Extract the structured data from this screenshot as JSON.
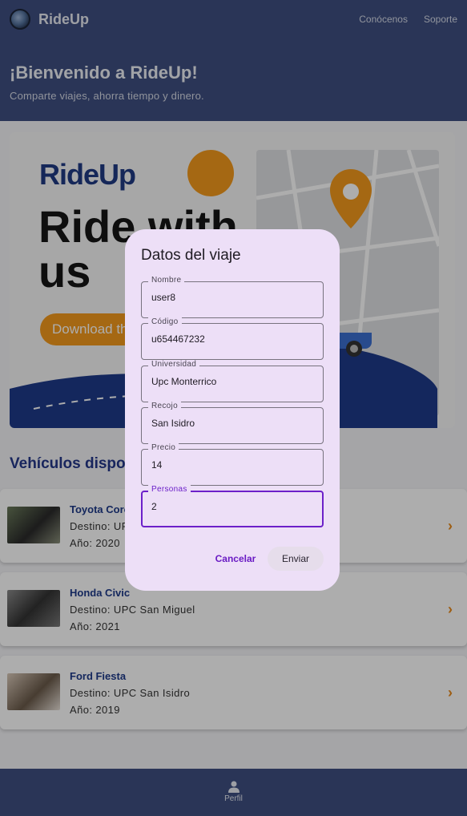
{
  "app": {
    "brand": "RideUp",
    "nav": [
      "Conócenos",
      "Soporte"
    ]
  },
  "hero": {
    "title": "¡Bienvenido a RideUp!",
    "subtitle": "Comparte viajes, ahorra tiempo y dinero."
  },
  "banner": {
    "logo": "RideUp",
    "headline_line1": "Ride with",
    "headline_line2": "us",
    "download": "Download the app"
  },
  "vehicles": {
    "title": "Vehículos disponibles",
    "items": [
      {
        "name": "Toyota Corolla",
        "destino": "Destino: UPC Monterrico",
        "anio": "Año: 2020"
      },
      {
        "name": "Honda Civic",
        "destino": "Destino: UPC San Miguel",
        "anio": "Año: 2021"
      },
      {
        "name": "Ford Fiesta",
        "destino": "Destino: UPC San Isidro",
        "anio": "Año: 2019"
      }
    ]
  },
  "bottom_nav": {
    "label": "Perfil"
  },
  "dialog": {
    "title": "Datos del viaje",
    "fields": [
      {
        "label": "Nombre",
        "value": "user8"
      },
      {
        "label": "Código",
        "value": "u654467232"
      },
      {
        "label": "Universidad",
        "value": "Upc Monterrico"
      },
      {
        "label": "Recojo",
        "value": "San Isidro"
      },
      {
        "label": "Precio",
        "value": "14"
      },
      {
        "label": "Personas",
        "value": "2"
      }
    ],
    "cancel": "Cancelar",
    "send": "Enviar"
  },
  "colors": {
    "primary": "#3e4f80",
    "accent": "#f49a1c",
    "dialog_bg": "#eddff7",
    "focus": "#6c20c9"
  }
}
